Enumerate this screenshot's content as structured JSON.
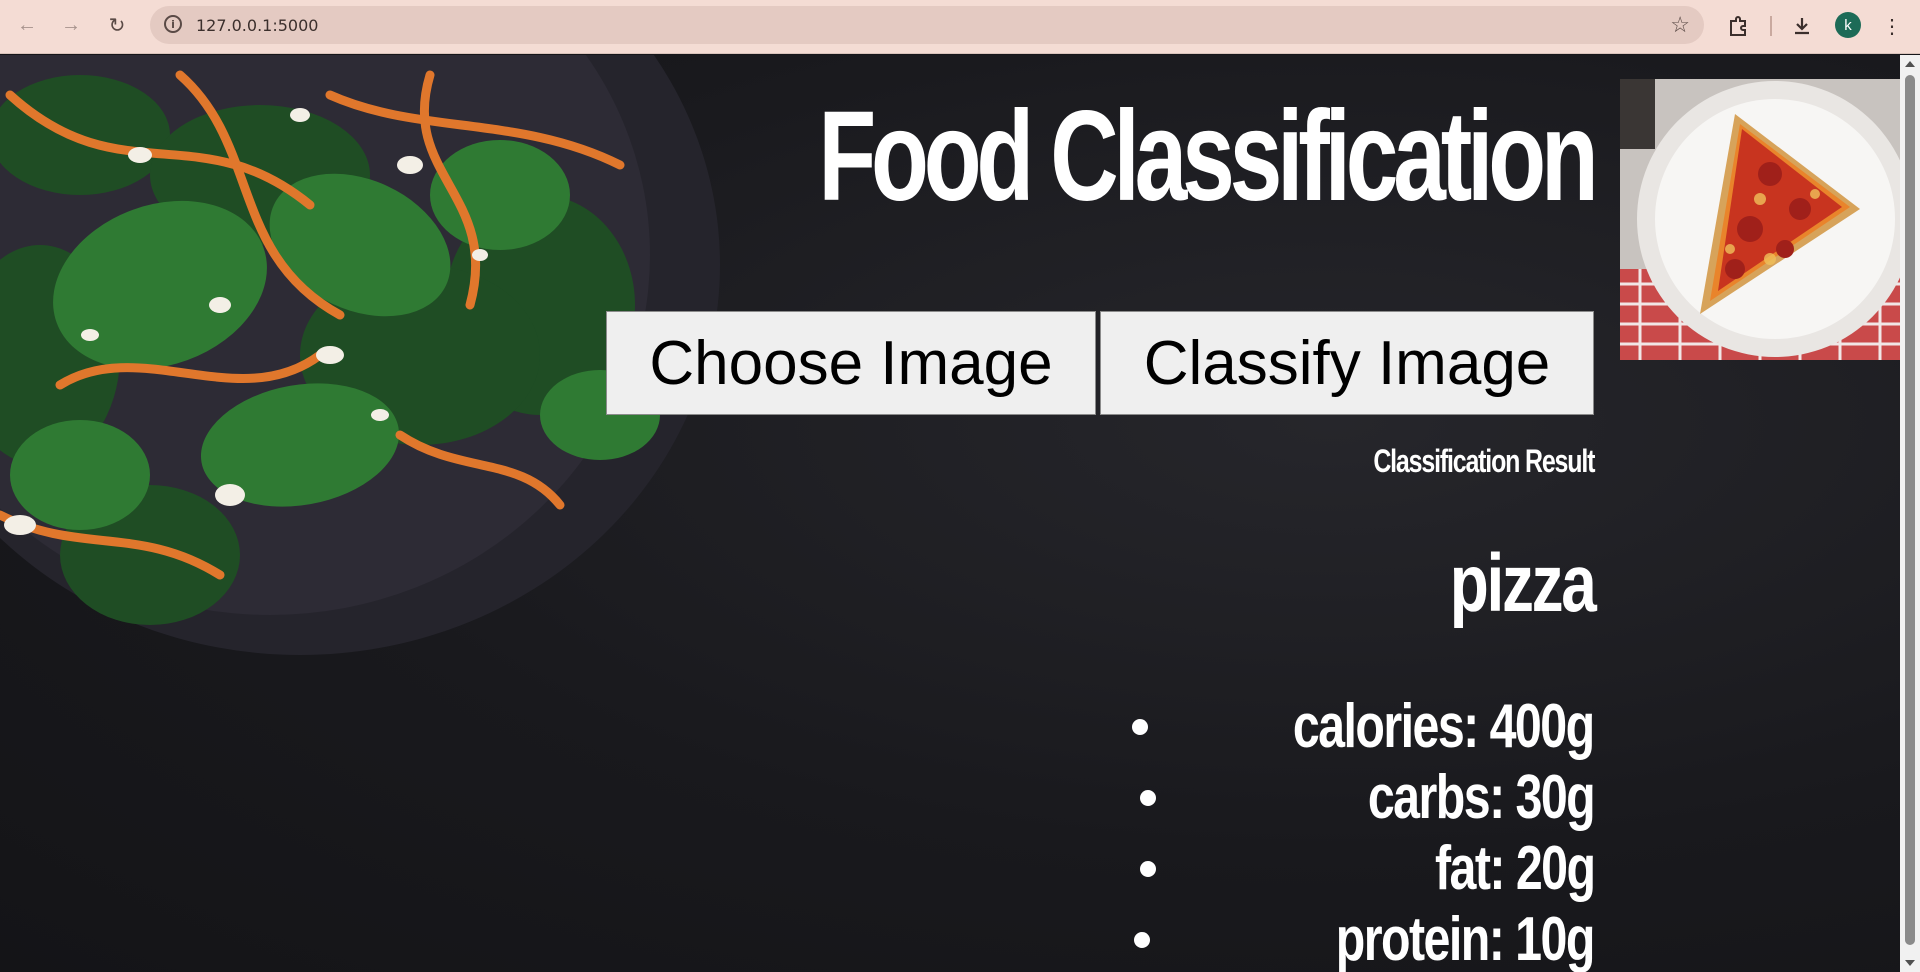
{
  "browser": {
    "url": "127.0.0.1:5000",
    "avatar_initial": "k"
  },
  "page": {
    "title": "Food Classification",
    "choose_button": "Choose Image",
    "classify_button": "Classify Image",
    "result_heading": "Classification Result",
    "prediction": "pizza",
    "nutrients": [
      "calories: 400g",
      "carbs: 30g",
      "fat: 20g",
      "protein: 10g"
    ]
  },
  "colors": {
    "background": "#16161a",
    "chrome": "#f4dcd4",
    "button": "#efefef",
    "text": "#ffffff"
  }
}
